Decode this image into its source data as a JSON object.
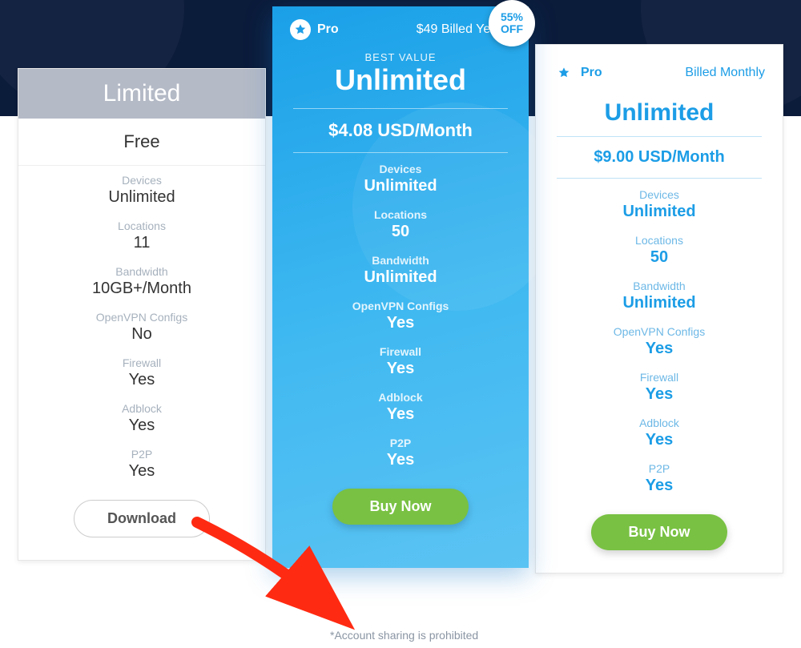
{
  "feature_labels": {
    "devices": "Devices",
    "locations": "Locations",
    "bandwidth": "Bandwidth",
    "openvpn": "OpenVPN Configs",
    "firewall": "Firewall",
    "adblock": "Adblock",
    "p2p": "P2P"
  },
  "plans": {
    "limited": {
      "title": "Limited",
      "price": "Free",
      "devices": "Unlimited",
      "locations": "11",
      "bandwidth": "10GB+/Month",
      "openvpn": "No",
      "firewall": "Yes",
      "adblock": "Yes",
      "p2p": "Yes",
      "cta": "Download"
    },
    "yearly": {
      "badge": "Pro",
      "billing": "$49 Billed Yearly",
      "best": "BEST VALUE",
      "title": "Unlimited",
      "price": "$4.08 USD/Month",
      "devices": "Unlimited",
      "locations": "50",
      "bandwidth": "Unlimited",
      "openvpn": "Yes",
      "firewall": "Yes",
      "adblock": "Yes",
      "p2p": "Yes",
      "cta": "Buy Now",
      "off_line1": "55%",
      "off_line2": "OFF"
    },
    "monthly": {
      "badge": "Pro",
      "billing": "Billed Monthly",
      "title": "Unlimited",
      "price": "$9.00 USD/Month",
      "devices": "Unlimited",
      "locations": "50",
      "bandwidth": "Unlimited",
      "openvpn": "Yes",
      "firewall": "Yes",
      "adblock": "Yes",
      "p2p": "Yes",
      "cta": "Buy Now"
    }
  },
  "footnote": "*Account sharing is prohibited"
}
